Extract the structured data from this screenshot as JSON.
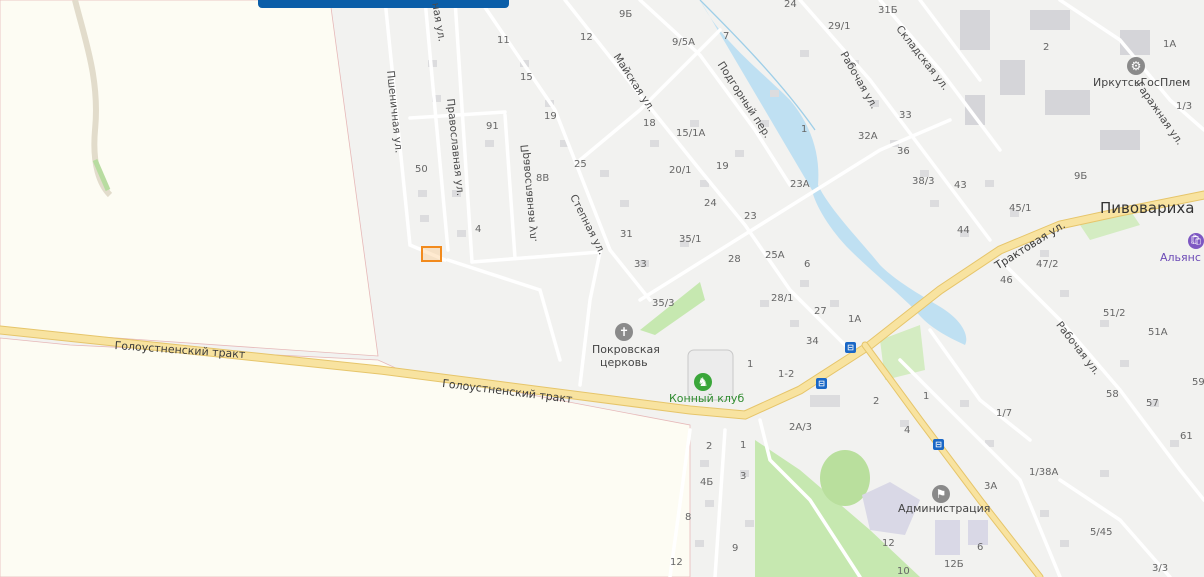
{
  "banner": {
    "text": ""
  },
  "place": {
    "village": "Пивовариха"
  },
  "roads": {
    "golousten_1": "Голоустненский тракт",
    "golousten_2": "Голоустненский тракт",
    "traktovaya": "Трактовая ул."
  },
  "streets": {
    "pshenichnaya": "Пшеничная ул.",
    "pravoslavnaya_1": "Православная ул.",
    "pravoslavnaya_top": "ная ул.",
    "pravoslavnaya_2": "Православная ул.",
    "stepnaya": "Степная ул.",
    "mayskaya": "Майская ул.",
    "podgorny": "Подгорный пер.",
    "rabochaya_1": "Рабочая ул.",
    "skladskaya": "Складская ул.",
    "garazhnaya": "Гаражная ул.",
    "rabochaya_2": "Рабочая ул."
  },
  "pois": {
    "church": "Покровская церковь",
    "church_line1": "Покровская",
    "church_line2": "церковь",
    "horse_club": "Конный клуб",
    "admin": "Администрация",
    "irkutsk_gos_plem": "ИркутскГосПлем",
    "alliance": "Альянс Н"
  },
  "icons": {
    "church": "church-icon",
    "horse": "horse-icon",
    "flag": "flag-icon",
    "factory": "factory-icon",
    "shop": "shop-icon",
    "bus": "bus-stop-icon"
  },
  "house_numbers": [
    "11",
    "12",
    "9Б",
    "24",
    "31Б",
    "29/1",
    "2",
    "1А",
    "9/5А",
    "7",
    "15",
    "19",
    "91",
    "50",
    "8В",
    "4",
    "25",
    "18",
    "15/1А",
    "20/1",
    "19",
    "24",
    "23",
    "31",
    "33",
    "35/1",
    "28",
    "25А",
    "6",
    "1",
    "23А",
    "32А",
    "33",
    "36",
    "38/3",
    "43",
    "44",
    "46",
    "9Б",
    "45/1",
    "47/2",
    "51/2",
    "51А",
    "58",
    "57",
    "59",
    "61",
    "1/3",
    "35/3",
    "27",
    "1А",
    "34",
    "28/1",
    "1",
    "1-2",
    "2",
    "2А/3",
    "1",
    "4",
    "1/7",
    "1/38А",
    "3А",
    "5/45",
    "3/3",
    "2",
    "1",
    "4Б",
    "3",
    "8",
    "9",
    "12",
    "12",
    "12Б",
    "6",
    "10"
  ],
  "colors": {
    "background": "#f2f2f0",
    "field": "#fdfcf3",
    "main_road": "#f8e3a0",
    "water": "#bfe0f2",
    "park": "#c6e8b0",
    "marker": "#f28a1c",
    "banner": "#0b5ea8",
    "bus_stop": "#1a67c6"
  }
}
